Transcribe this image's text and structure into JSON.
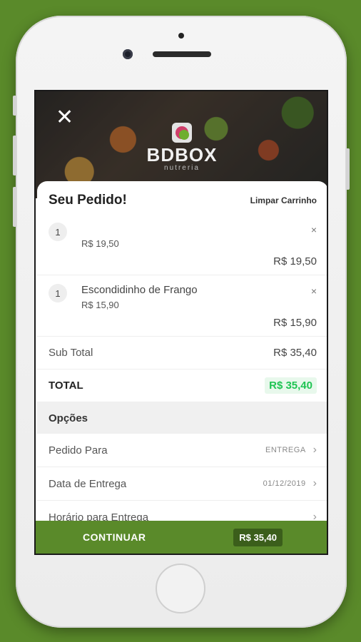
{
  "header": {
    "close_icon": "close-icon",
    "logo_name": "BDBOX",
    "logo_sub": "nutreria"
  },
  "cart": {
    "title": "Seu Pedido!",
    "clear_label": "Limpar Carrinho",
    "items": [
      {
        "qty": "1",
        "name": "",
        "price": "R$ 19,50",
        "remove": "×",
        "total": "R$ 19,50"
      },
      {
        "qty": "1",
        "name": "Escondidinho de Frango",
        "price": "R$ 15,90",
        "remove": "×",
        "total": "R$ 15,90"
      }
    ],
    "subtotal_label": "Sub Total",
    "subtotal_value": "R$ 35,40",
    "total_label": "TOTAL",
    "total_value": "R$ 35,40"
  },
  "options": {
    "title": "Opções",
    "rows": [
      {
        "label": "Pedido Para",
        "value": "ENTREGA"
      },
      {
        "label": "Data de Entrega",
        "value": "01/12/2019"
      },
      {
        "label": "Horário para Entrega",
        "value": ""
      }
    ]
  },
  "footer": {
    "continue_label": "CONTINUAR",
    "total": "R$ 35,40"
  },
  "colors": {
    "brand_green": "#5a8a2a",
    "total_green": "#1fc453"
  }
}
